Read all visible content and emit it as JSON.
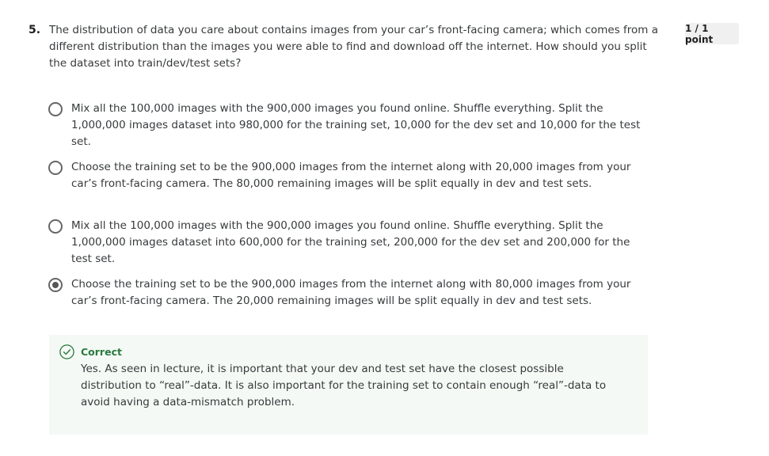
{
  "question": {
    "number": "5.",
    "text": "The distribution of data you care about contains images from your car’s front-facing camera; which comes from a different distribution than the images you were able to find and download off the internet. How should you split the dataset into train/dev/test sets?",
    "points": "1 / 1 point"
  },
  "options": [
    {
      "text": "Mix all the 100,000 images with the 900,000 images you found online. Shuffle everything. Split the 1,000,000 images dataset into 980,000 for the training set, 10,000 for the dev set and 10,000 for the test set.",
      "selected": false
    },
    {
      "text": "Choose the training set to be the 900,000 images from the internet along with 20,000 images from your car’s front-facing camera. The 80,000 remaining images will be split equally in dev and test sets.",
      "selected": false
    },
    {
      "text": "Mix all the 100,000 images with the 900,000 images you found online. Shuffle everything. Split the 1,000,000 images dataset into 600,000 for the training set, 200,000 for the dev set and 200,000 for the test set.",
      "selected": false
    },
    {
      "text": "Choose the training set to be the 900,000 images from the internet along with 80,000 images from your car’s front-facing camera. The 20,000 remaining images will be split equally in dev and test sets.",
      "selected": true
    }
  ],
  "feedback": {
    "icon": "check-circle-icon",
    "status": "Correct",
    "text": "Yes. As seen in lecture, it is important that your dev and test set have the closest possible distribution to “real”-data. It is also important for the training set to contain enough “real”-data to avoid having a data-mismatch problem.",
    "color": "#2a7a3e"
  }
}
